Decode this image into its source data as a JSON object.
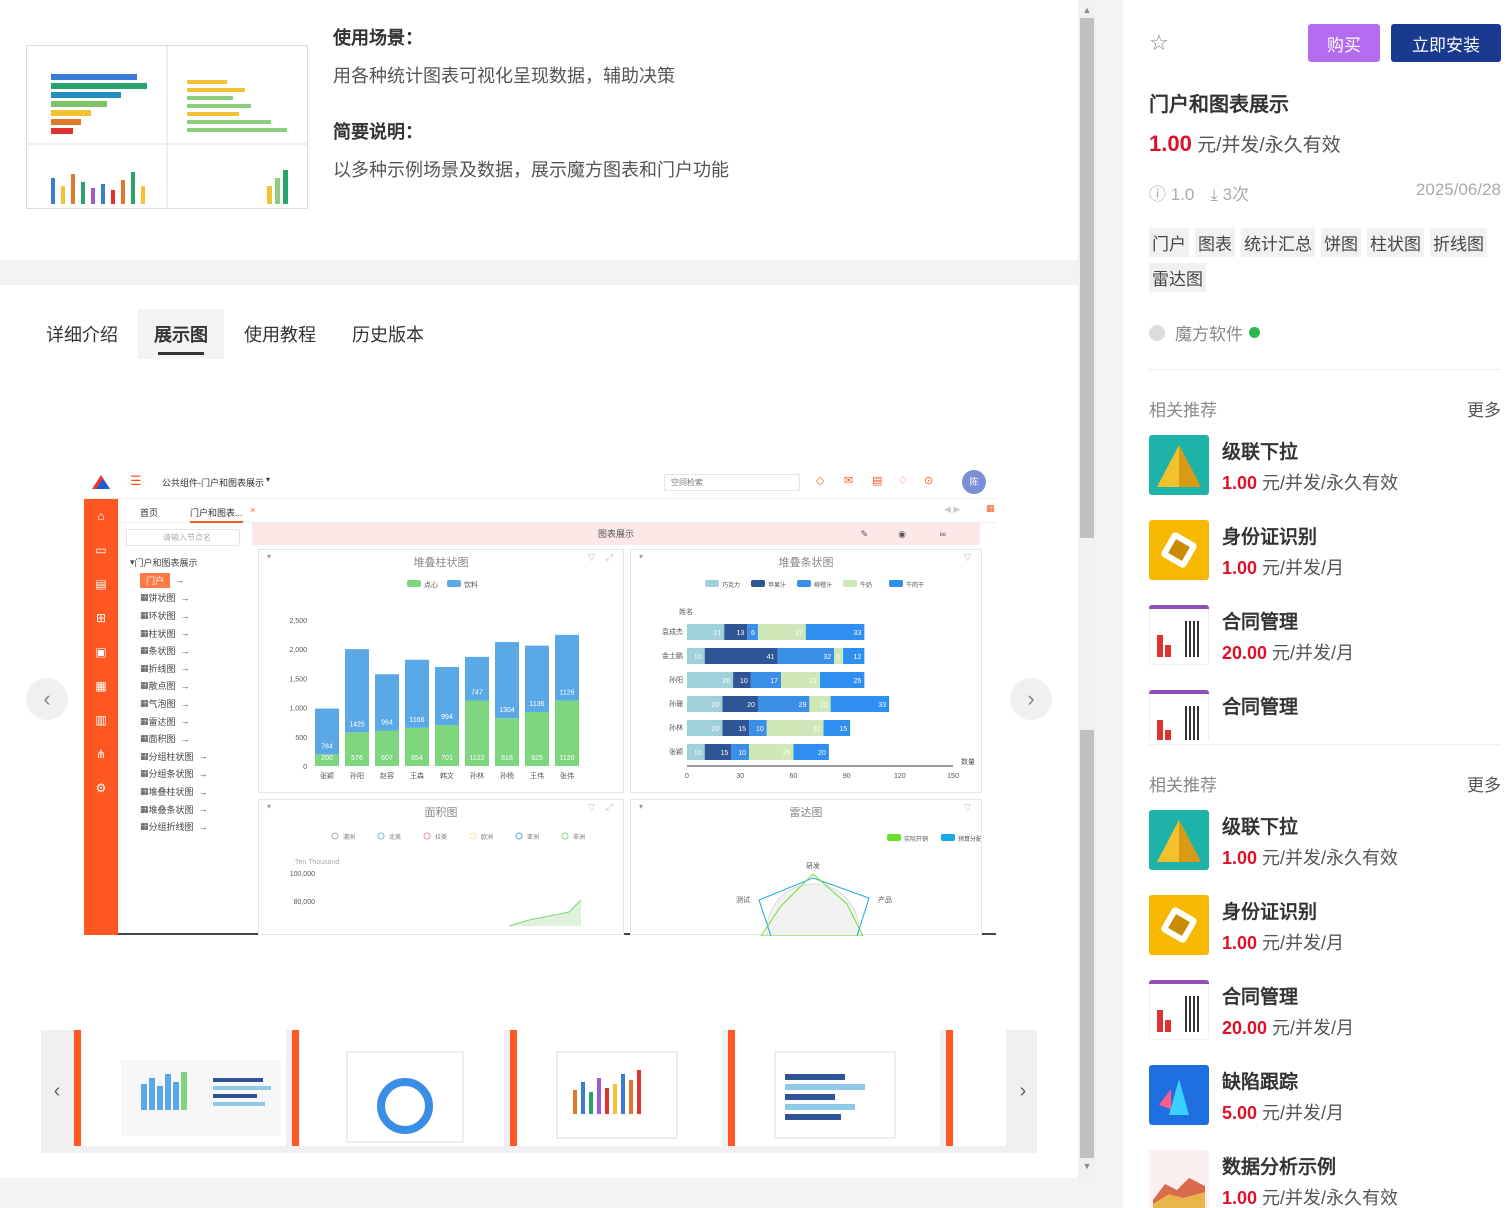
{
  "intro": {
    "scene_label": "使用场景：",
    "scene_text": "用各种统计图表可视化呈现数据，辅助决策",
    "brief_label": "简要说明：",
    "brief_text": "以多种示例场景及数据，展示魔方图表和门户功能"
  },
  "tabs": [
    "详细介绍",
    "展示图",
    "使用教程",
    "历史版本"
  ],
  "active_tab": 1,
  "app": {
    "title": "公共组件-门户和图表展示",
    "search_placeholder": "空间检索",
    "avatar": "陈",
    "tab_home": "首页",
    "tab_current": "门户和图表...",
    "tree_search": "请输入节点名",
    "header": "图表展示",
    "tree": [
      "门户和图表展示",
      "门户",
      "饼状图",
      "环状图",
      "柱状图",
      "条状图",
      "折线图",
      "散点图",
      "气泡图",
      "雷达图",
      "面积图",
      "分组柱状图",
      "分组条状图",
      "堆叠柱状图",
      "堆叠条状图",
      "分组折线图"
    ]
  },
  "chart_data": [
    {
      "type": "bar",
      "title": "堆叠柱状图",
      "categories": [
        "张颖",
        "孙阳",
        "赵容",
        "王森",
        "韩文",
        "孙林",
        "孙杨",
        "王伟",
        "张伟"
      ],
      "series": [
        {
          "name": "点心",
          "values": [
            200,
            576,
            607,
            654,
            701,
            1122,
            818,
            925,
            1120
          ]
        },
        {
          "name": "饮料",
          "values": [
            784,
            1425,
            964,
            1166,
            994,
            747,
            1304,
            1136,
            1126
          ]
        }
      ],
      "ylim": [
        0,
        2500
      ],
      "yticks": [
        "0",
        "500",
        "1,000",
        "1,500",
        "2,000",
        "2,500"
      ]
    },
    {
      "type": "bar",
      "title": "堆叠条状图",
      "ylabel": "姓名",
      "xlabel": "数量",
      "categories": [
        "袁成杰",
        "金士鹏",
        "孙阳",
        "孙珊",
        "孙林",
        "张颖"
      ],
      "series": [
        {
          "name": "巧克力",
          "values": [
            21,
            10,
            26,
            20,
            20,
            10
          ]
        },
        {
          "name": "苹果汁",
          "values": [
            13,
            41,
            10,
            20,
            15,
            15
          ]
        },
        {
          "name": "柳橙汁",
          "values": [
            6,
            32,
            17,
            29,
            10,
            10
          ]
        },
        {
          "name": "牛奶",
          "values": [
            27,
            5,
            22,
            12,
            32,
            25
          ]
        },
        {
          "name": "牛肉干",
          "values": [
            33,
            12,
            25,
            33,
            15,
            20
          ]
        }
      ],
      "xlim": [
        0,
        150
      ],
      "xticks": [
        "0",
        "30",
        "60",
        "90",
        "120",
        "150"
      ]
    },
    {
      "type": "area",
      "title": "面积图",
      "legend": [
        "澳洲",
        "北美",
        "拉美",
        "欧洲",
        "亚洲",
        "非洲"
      ],
      "ylabel": "Ten Thousand",
      "yticks": [
        "100,000",
        "80,000"
      ]
    },
    {
      "type": "radar",
      "title": "雷达图",
      "legend": [
        "实际开销",
        "预算分配"
      ],
      "axes": [
        "研发",
        "产品",
        "测试"
      ]
    }
  ],
  "sidebar": {
    "buy": "购买",
    "install": "立即安装",
    "title": "门户和图表展示",
    "price": "1.00",
    "price_unit": " 元/并发/永久有效",
    "version": "ⓘ 1.0",
    "downloads": "⤓ 3次",
    "date": "2025/06/28",
    "tags": [
      "门户",
      "图表",
      "统计汇总",
      "饼图",
      "柱状图",
      "折线图",
      "雷达图"
    ],
    "vendor": "魔方软件",
    "rec_title": "相关推荐",
    "more": "更多",
    "recs_a": [
      {
        "name": "级联下拉",
        "price": "1.00",
        "unit": " 元/并发/永久有效",
        "icon": "teal"
      },
      {
        "name": "身份证识别",
        "price": "1.00",
        "unit": " 元/并发/月",
        "icon": "gold"
      },
      {
        "name": "合同管理",
        "price": "20.00",
        "unit": " 元/并发/月",
        "icon": "chart"
      },
      {
        "name": "合同管理",
        "price": "",
        "unit": "",
        "icon": "chart"
      }
    ],
    "recs_b": [
      {
        "name": "级联下拉",
        "price": "1.00",
        "unit": " 元/并发/永久有效",
        "icon": "teal"
      },
      {
        "name": "身份证识别",
        "price": "1.00",
        "unit": " 元/并发/月",
        "icon": "gold"
      },
      {
        "name": "合同管理",
        "price": "20.00",
        "unit": " 元/并发/月",
        "icon": "chart"
      },
      {
        "name": "缺陷跟踪",
        "price": "5.00",
        "unit": " 元/并发/月",
        "icon": "blue"
      },
      {
        "name": "数据分析示例",
        "price": "1.00",
        "unit": " 元/并发/永久有效",
        "icon": "area"
      }
    ]
  }
}
